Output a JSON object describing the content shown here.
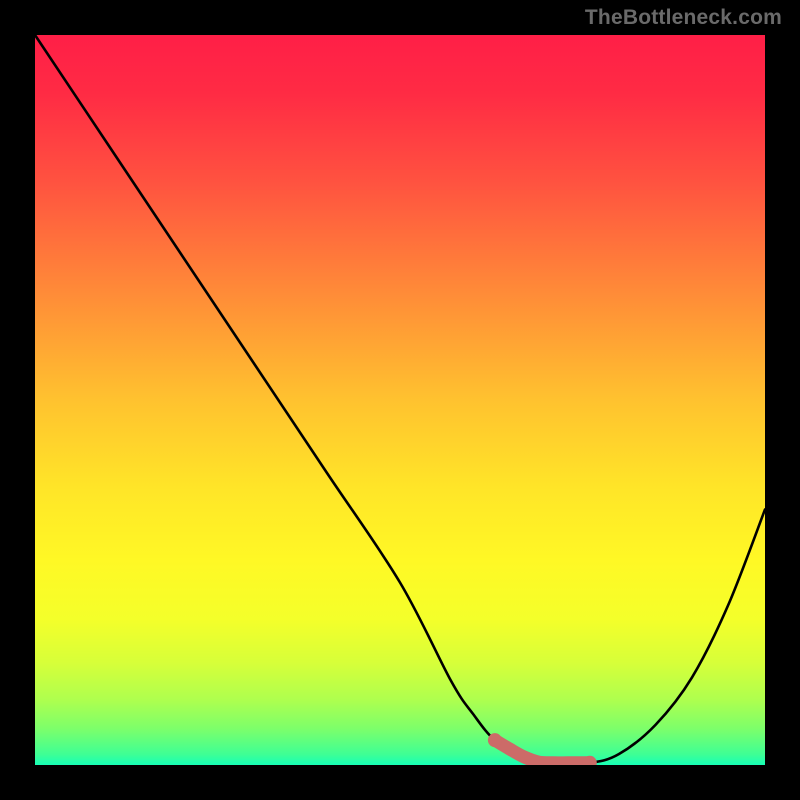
{
  "attribution": "TheBottleneck.com",
  "chart_data": {
    "type": "line",
    "title": "",
    "xlabel": "",
    "ylabel": "",
    "xlim": [
      0,
      100
    ],
    "ylim": [
      0,
      100
    ],
    "series": [
      {
        "name": "bottleneck-curve",
        "x": [
          0,
          10,
          20,
          30,
          40,
          50,
          57,
          60,
          63,
          67,
          71,
          76,
          80,
          85,
          90,
          95,
          100
        ],
        "values": [
          100,
          85,
          70,
          55,
          40,
          25,
          11.5,
          7,
          3.4,
          1.1,
          0.3,
          0.3,
          1.5,
          5.5,
          12,
          22,
          35
        ]
      },
      {
        "name": "highlight-segment",
        "x": [
          63,
          65,
          67,
          69,
          71,
          73,
          75,
          76
        ],
        "values": [
          3.4,
          2.2,
          1.1,
          0.4,
          0.3,
          0.3,
          0.3,
          0.3
        ]
      }
    ],
    "gradient_stops": [
      {
        "offset": 0.0,
        "color": "#ff1f47"
      },
      {
        "offset": 0.08,
        "color": "#ff2b44"
      },
      {
        "offset": 0.2,
        "color": "#ff5240"
      },
      {
        "offset": 0.35,
        "color": "#ff8a38"
      },
      {
        "offset": 0.5,
        "color": "#ffc22f"
      },
      {
        "offset": 0.62,
        "color": "#ffe528"
      },
      {
        "offset": 0.72,
        "color": "#fff825"
      },
      {
        "offset": 0.8,
        "color": "#f4ff2a"
      },
      {
        "offset": 0.86,
        "color": "#d7ff39"
      },
      {
        "offset": 0.91,
        "color": "#afff4e"
      },
      {
        "offset": 0.95,
        "color": "#7dff6a"
      },
      {
        "offset": 0.985,
        "color": "#3fff94"
      },
      {
        "offset": 1.0,
        "color": "#17ffb6"
      }
    ],
    "colors": {
      "curve": "#000000",
      "highlight": "#cc6b68",
      "frame": "#000000"
    }
  }
}
